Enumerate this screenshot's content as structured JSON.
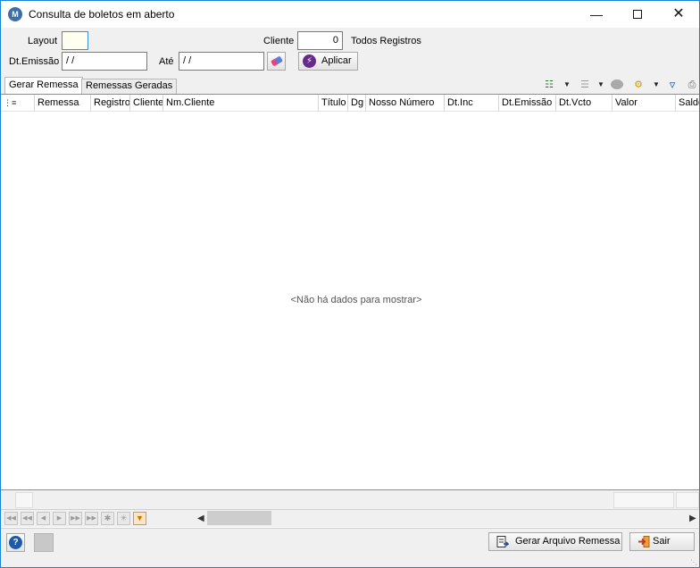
{
  "window": {
    "title": "Consulta de boletos em aberto",
    "app_icon_letter": "M",
    "minimize": "—",
    "close": "✕"
  },
  "form": {
    "layout_label": "Layout",
    "layout_value": "",
    "cliente_label": "Cliente",
    "cliente_value": "0",
    "todos_label": "Todos Registros",
    "dt_emissao_label": "Dt.Emissão",
    "dt_emissao_value": " / /",
    "ate_label": "Até",
    "ate_value": " / /",
    "apply_label": "Aplicar"
  },
  "tabs": [
    {
      "label": "Gerar Remessa",
      "active": true
    },
    {
      "label": "Remessas Geradas",
      "active": false
    }
  ],
  "grid": {
    "columns": [
      "Remessa",
      "Registro",
      "Cliente",
      "Nm.Cliente",
      "Título",
      "Dg",
      "Nosso Número",
      "Dt.Inc",
      "Dt.Emissão",
      "Dt.Vcto",
      "Valor",
      "Saldo"
    ],
    "empty_message": "<Não há dados para mostrar>"
  },
  "bottom": {
    "gerar_label": "Gerar Arquivo Remessa",
    "sair_label": "Sair",
    "help_symbol": "?"
  },
  "colors": {
    "window_border": "#1883d7",
    "chrome": "#f0f0f0",
    "accent_purple": "#6a2a8c"
  }
}
